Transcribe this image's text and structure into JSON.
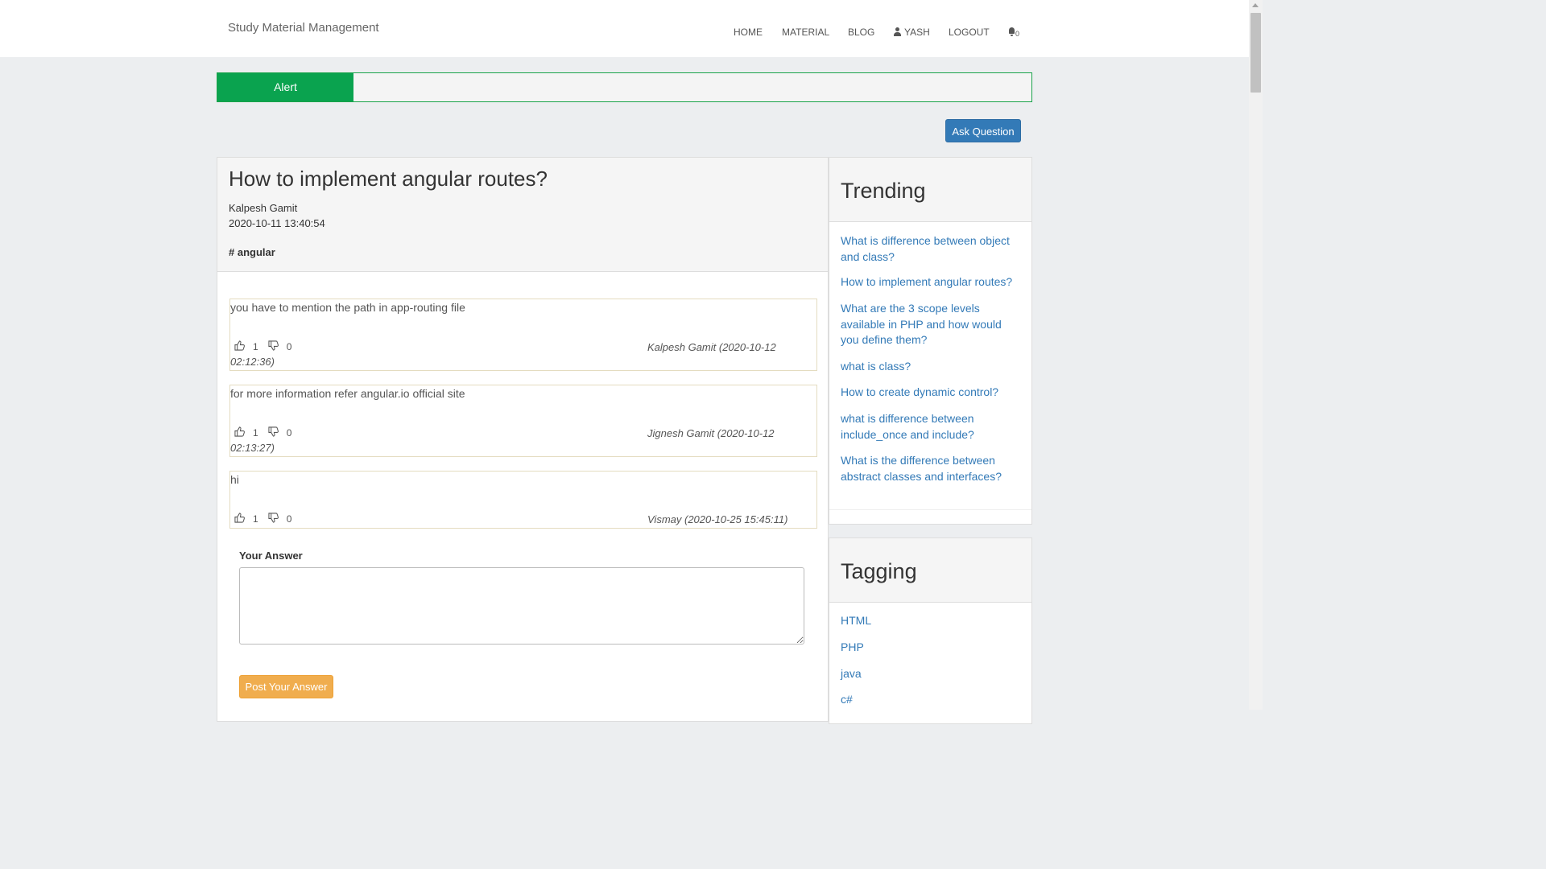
{
  "navbar": {
    "brand": "Study Material Management",
    "home": "HOME",
    "material": "MATERIAL",
    "blog": "BLOG",
    "user": "YASH",
    "logout": "LOGOUT",
    "notifications": "0"
  },
  "alert": {
    "label": "Alert",
    "message": ""
  },
  "ask_button": "Ask Question",
  "question": {
    "title": "How to implement angular routes?",
    "author": "Kalpesh Gamit",
    "date": "2020-10-11 13:40:54",
    "tag": "# angular"
  },
  "answers": [
    {
      "text": "you have to mention the path in app-routing file",
      "likes": "1",
      "dislikes": "0",
      "meta": "Kalpesh Gamit (2020-10-12 02:12:36)",
      "meta_line1": "Kalpesh Gamit (2020-10-12",
      "meta_line2": "02:12:36)"
    },
    {
      "text": "for more information refer angular.io official site",
      "likes": "1",
      "dislikes": "0",
      "meta": "Jignesh Gamit (2020-10-12 02:13:27)",
      "meta_line1": "Jignesh Gamit (2020-10-12",
      "meta_line2": "02:13:27)"
    },
    {
      "text": "hi",
      "likes": "1",
      "dislikes": "0",
      "meta": "Vismay (2020-10-25 15:45:11)",
      "meta_line1": "Vismay (2020-10-25 15:45:11)",
      "meta_line2": ""
    }
  ],
  "your_answer": {
    "label": "Your Answer",
    "value": "",
    "submit": "Post Your Answer"
  },
  "trending": {
    "title": "Trending",
    "items": [
      "What is difference between object and class?",
      "How to implement angular routes?",
      "What are the 3 scope levels available in PHP and how would you define them?",
      "what is class?",
      "How to create dynamic control?",
      "what is difference between include_once and include?",
      "What is the difference between abstract classes and interfaces?"
    ]
  },
  "tagging": {
    "title": "Tagging",
    "items": [
      "HTML",
      "PHP",
      "java",
      "c#"
    ]
  },
  "colors": {
    "alert_green": "#0aa34f",
    "primary_blue": "#337ab7",
    "warning_orange": "#f0ad4e",
    "link_blue": "#337ab7"
  }
}
